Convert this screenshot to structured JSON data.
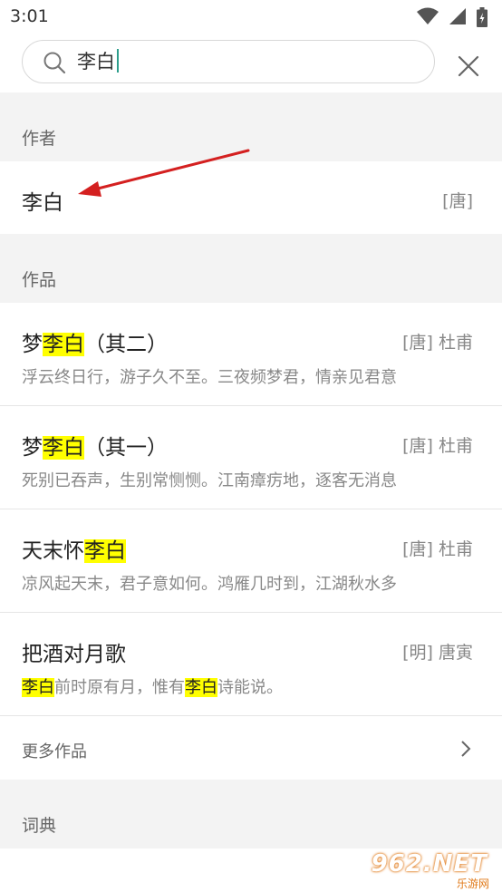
{
  "status_bar": {
    "time": "3:01"
  },
  "search": {
    "query": "李白"
  },
  "sections": {
    "authors_header": "作者",
    "works_header": "作品",
    "dictionary_header": "词典"
  },
  "author": {
    "name": "李白",
    "dynasty": "[唐]"
  },
  "works": [
    {
      "title_parts": [
        "梦",
        "李白",
        "（其二）"
      ],
      "meta": "[唐] 杜甫",
      "excerpt_parts": [
        "浮云终日行，游子久不至。三夜频梦君，情亲见君意"
      ]
    },
    {
      "title_parts": [
        "梦",
        "李白",
        "（其一）"
      ],
      "meta": "[唐] 杜甫",
      "excerpt_parts": [
        "死别已吞声，生别常恻恻。江南瘴疠地，逐客无消息"
      ]
    },
    {
      "title_parts": [
        "天末怀",
        "李白"
      ],
      "meta": "[唐] 杜甫",
      "excerpt_parts": [
        "凉风起天末，君子意如何。鸿雁几时到，江湖秋水多"
      ]
    },
    {
      "title_parts": [
        "把酒对月歌"
      ],
      "meta": "[明] 唐寅",
      "excerpt_parts": [
        "李白",
        "前时原有月，惟有",
        "李白",
        "诗能说。"
      ]
    }
  ],
  "more_works_label": "更多作品",
  "watermark": {
    "text": "962.NET",
    "sub": "乐游网"
  },
  "colors": {
    "highlight": "#ffff00",
    "caret": "#2e9e8c",
    "arrow": "#d42020"
  }
}
